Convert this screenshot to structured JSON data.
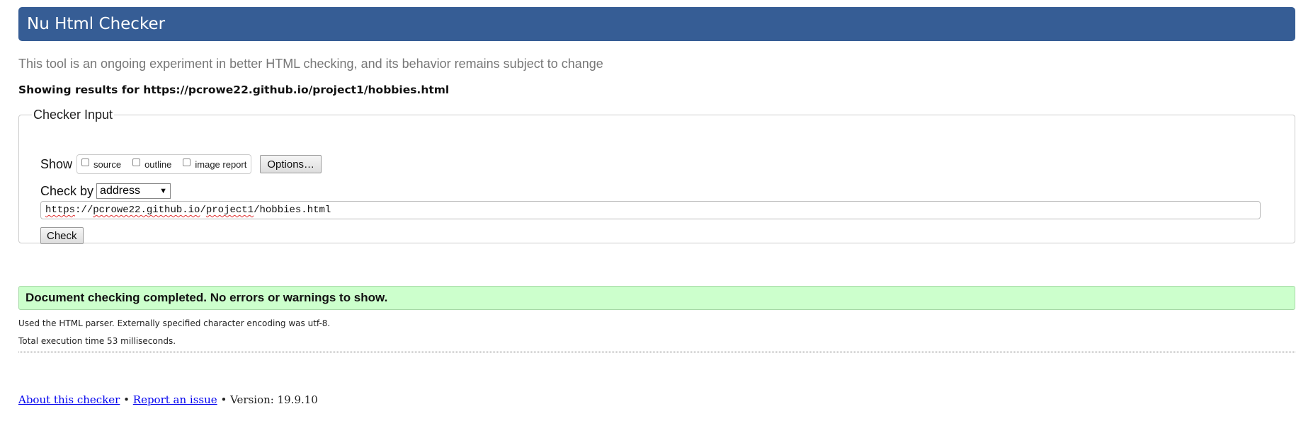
{
  "header": {
    "title": "Nu Html Checker"
  },
  "tagline": "This tool is an ongoing experiment in better HTML checking, and its behavior remains subject to change",
  "results_for": "Showing results for https://pcrowe22.github.io/project1/hobbies.html",
  "checker_input": {
    "legend": "Checker Input",
    "show_label": "Show",
    "options": [
      {
        "label": "source",
        "checked": false
      },
      {
        "label": "outline",
        "checked": false
      },
      {
        "label": "image report",
        "checked": false
      }
    ],
    "options_button": "Options…",
    "check_by_label": "Check by",
    "check_by_value": "address",
    "url_parts": [
      "https",
      "://",
      "pcrowe22.github.io",
      "/",
      "project1",
      "/hobbies.html"
    ],
    "check_button": "Check"
  },
  "result": {
    "success_message": "Document checking completed. No errors or warnings to show.",
    "parser_note": "Used the HTML parser. Externally specified character encoding was utf-8.",
    "execution_time": "Total execution time 53 milliseconds."
  },
  "footer": {
    "about_link": "About this checker",
    "separator": "•",
    "report_link": "Report an issue",
    "version": "Version: 19.9.10"
  },
  "colors": {
    "header_bg": "#365d95",
    "success_bg": "#ccffcc",
    "link": "#0000ee"
  }
}
